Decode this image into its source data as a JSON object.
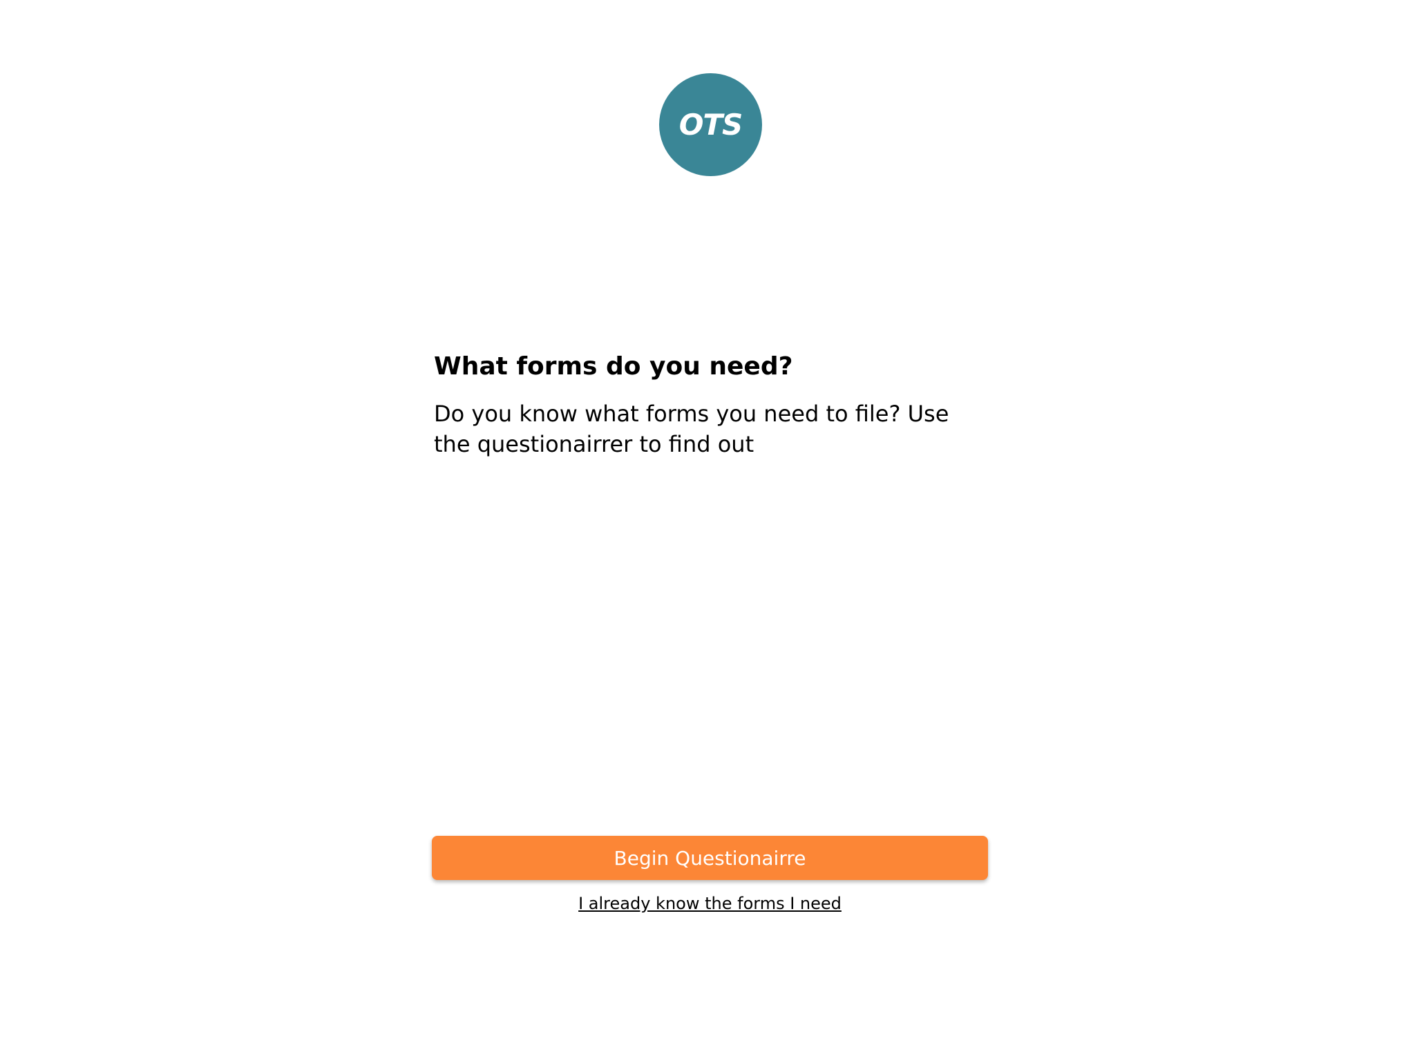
{
  "logo": {
    "text": "OTS",
    "background_color": "#3a8696"
  },
  "main": {
    "heading": "What forms do you need?",
    "description": "Do you know what forms you need to file? Use the questionairrer to find out"
  },
  "actions": {
    "begin_label": "Begin Questionairre",
    "begin_color": "#fc8636",
    "skip_link_label": "I already know the forms I need"
  }
}
